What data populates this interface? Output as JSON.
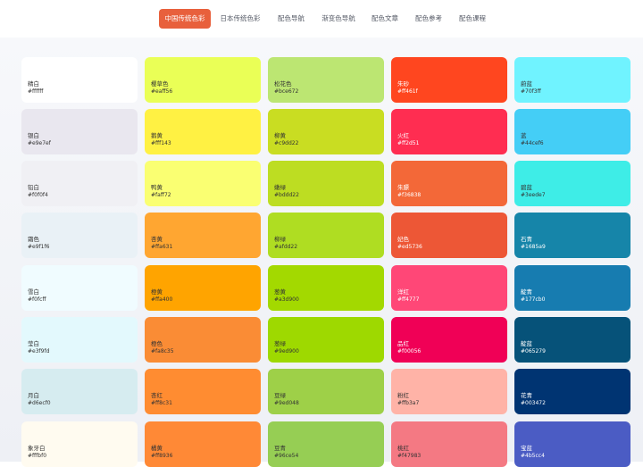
{
  "nav": {
    "items": [
      {
        "label": "中国传统色彩",
        "active": true
      },
      {
        "label": "日本传统色彩",
        "active": false
      },
      {
        "label": "配色导航",
        "active": false
      },
      {
        "label": "渐变色导航",
        "active": false
      },
      {
        "label": "配色文章",
        "active": false
      },
      {
        "label": "配色参考",
        "active": false
      },
      {
        "label": "配色课程",
        "active": false
      }
    ],
    "active_color": "#e8603c"
  },
  "colors": [
    [
      {
        "name": "精白",
        "hex": "#ffffff"
      },
      {
        "name": "银白",
        "hex": "#e9e7ef"
      },
      {
        "name": "铅白",
        "hex": "#f0f0f4"
      },
      {
        "name": "霜色",
        "hex": "#e9f1f6"
      },
      {
        "name": "雪白",
        "hex": "#f0fcff"
      },
      {
        "name": "莹白",
        "hex": "#e3f9fd"
      },
      {
        "name": "月白",
        "hex": "#d6ecf0"
      },
      {
        "name": "象牙白",
        "hex": "#fffbf0"
      }
    ],
    [
      {
        "name": "樱草色",
        "hex": "#eaff56"
      },
      {
        "name": "鹅黄",
        "hex": "#fff143"
      },
      {
        "name": "鸭黄",
        "hex": "#faff72"
      },
      {
        "name": "杏黄",
        "hex": "#ffa631"
      },
      {
        "name": "橙黄",
        "hex": "#ffa400"
      },
      {
        "name": "橙色",
        "hex": "#fa8c35"
      },
      {
        "name": "杏红",
        "hex": "#ff8c31"
      },
      {
        "name": "橘黄",
        "hex": "#ff8936"
      }
    ],
    [
      {
        "name": "松花色",
        "hex": "#bce672"
      },
      {
        "name": "柳黄",
        "hex": "#c9dd22"
      },
      {
        "name": "嫩绿",
        "hex": "#bddd22"
      },
      {
        "name": "柳绿",
        "hex": "#afdd22"
      },
      {
        "name": "葱黄",
        "hex": "#a3d900"
      },
      {
        "name": "葱绿",
        "hex": "#9ed900"
      },
      {
        "name": "豆绿",
        "hex": "#9ed048"
      },
      {
        "name": "豆青",
        "hex": "#96ce54"
      }
    ],
    [
      {
        "name": "朱砂",
        "hex": "#ff461f"
      },
      {
        "name": "火红",
        "hex": "#ff2d51"
      },
      {
        "name": "朱膘",
        "hex": "#f36838"
      },
      {
        "name": "妃色",
        "hex": "#ed5736"
      },
      {
        "name": "洋红",
        "hex": "#ff4777"
      },
      {
        "name": "品红",
        "hex": "#f00056"
      },
      {
        "name": "粉红",
        "hex": "#ffb3a7"
      },
      {
        "name": "桃红",
        "hex": "#f47983"
      }
    ],
    [
      {
        "name": "蔚蓝",
        "hex": "#70f3ff"
      },
      {
        "name": "蓝",
        "hex": "#44cef6"
      },
      {
        "name": "碧蓝",
        "hex": "#3eede7"
      },
      {
        "name": "石青",
        "hex": "#1685a9"
      },
      {
        "name": "靛青",
        "hex": "#177cb0"
      },
      {
        "name": "靛蓝",
        "hex": "#065279"
      },
      {
        "name": "花青",
        "hex": "#003472"
      },
      {
        "name": "宝蓝",
        "hex": "#4b5cc4"
      }
    ]
  ]
}
